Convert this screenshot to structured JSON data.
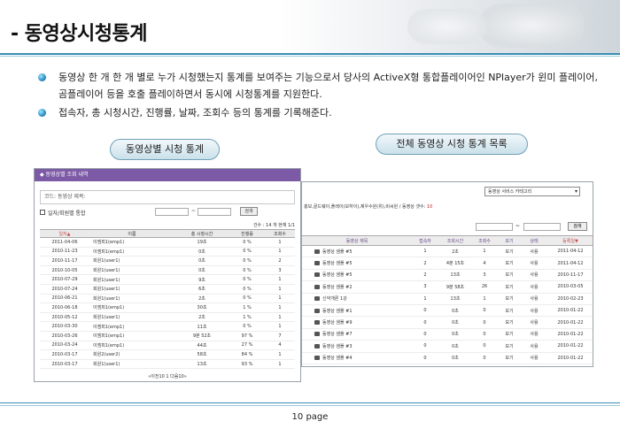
{
  "title": "- 동영상시청통계",
  "bullets": [
    "동영상 한 개 한 개 별로 누가 시청했는지 통계를 보여주는 기능으로서 당사의 ActiveX형 통합플레이어인 NPlayer가 윈미 플레이어, 곰플레이어 등을 호출 플레이하면서 동시에 시청통계를 지원한다.",
    "접속자, 총 시청시간, 진행률, 날짜, 조회수 등의 통계를 기록해준다."
  ],
  "labels": {
    "left_pill": "동영상별 시청 통계",
    "right_pill": "전체 동영상 시청 통계 목록"
  },
  "left_shot": {
    "header": "◆ 동영상별 조회 내역",
    "search_text": "코드: 동영상 제목:",
    "option_label": "일자/회원별 통합",
    "tilde": "~",
    "button": "검색",
    "count": "건수 : 14 개   현재 1/1",
    "columns": [
      "일자▲",
      "이름",
      "총 시청시간",
      "진행률",
      "조회수"
    ],
    "rows": [
      [
        "2011-04-06",
        "이엠피1(emp1)",
        "19초",
        "0 %",
        "1"
      ],
      [
        "2010-11-23",
        "이엠피1(emp1)",
        "0초",
        "0 %",
        "1"
      ],
      [
        "2010-11-17",
        "회원1(user1)",
        "0초",
        "0 %",
        "2"
      ],
      [
        "2010-10-05",
        "회원1(user1)",
        "0초",
        "0 %",
        "3"
      ],
      [
        "2010-07-29",
        "회원1(user1)",
        "9초",
        "0 %",
        "1"
      ],
      [
        "2010-07-24",
        "회원1(user1)",
        "6초",
        "0 %",
        "1"
      ],
      [
        "2010-06-21",
        "회원1(user1)",
        "2초",
        "0 %",
        "1"
      ],
      [
        "2010-06-18",
        "이엠피1(emp1)",
        "30초",
        "1 %",
        "1"
      ],
      [
        "2010-05-12",
        "회원1(user1)",
        "2초",
        "1 %",
        "1"
      ],
      [
        "2010-03-30",
        "이엠피1(emp1)",
        "11초",
        "0 %",
        "1"
      ],
      [
        "2010-03-26",
        "이엠피1(emp1)",
        "9분 52초",
        "97 %",
        "7"
      ],
      [
        "2010-03-24",
        "이엠피1(emp1)",
        "44초",
        "27 %",
        "4"
      ],
      [
        "2010-03-17",
        "회원2(user2)",
        "58초",
        "84 %",
        "1"
      ],
      [
        "2010-03-17",
        "회원1(user1)",
        "13초",
        "93 %",
        "1"
      ]
    ],
    "pager": "«이전10  1  다음10»"
  },
  "right_shot": {
    "select": "동영상 서비스 카테고리",
    "breadcrumb_prefix": "홍보,골드웨이,플레이(보하이),제우수원(위),비씨원 / 동영상 갯수:",
    "breadcrumb_count": "10",
    "tilde": "~",
    "button": "검색",
    "columns": [
      "동영상 제목",
      "접속자",
      "조회시간",
      "조회수",
      "보기",
      "상태",
      "등록일▼"
    ],
    "rows": [
      [
        "동영상 샘플 #5",
        "1",
        "2초",
        "1",
        "보기",
        "사용",
        "2011-04-12"
      ],
      [
        "동영상 샘플 #5",
        "2",
        "4분 15초",
        "4",
        "보기",
        "사용",
        "2011-04-12"
      ],
      [
        "동영상 샘플 #5",
        "2",
        "13초",
        "3",
        "보기",
        "사용",
        "2010-11-17"
      ],
      [
        "동영상 샘플 #2",
        "3",
        "9분 58초",
        "26",
        "보기",
        "사용",
        "2010-03-05"
      ],
      [
        "신약개론 1강",
        "1",
        "13초",
        "1",
        "보기",
        "사용",
        "2010-02-23"
      ],
      [
        "동영상 샘플 #1",
        "0",
        "0초",
        "0",
        "보기",
        "사용",
        "2010-01-22"
      ],
      [
        "동영상 샘플 #9",
        "0",
        "0초",
        "0",
        "보기",
        "사용",
        "2010-01-22"
      ],
      [
        "동영상 샘플 #7",
        "0",
        "0초",
        "0",
        "보기",
        "사용",
        "2010-01-22"
      ],
      [
        "동영상 샘플 #3",
        "0",
        "0초",
        "0",
        "보기",
        "사용",
        "2010-01-22"
      ],
      [
        "동영상 샘플 #4",
        "0",
        "0초",
        "0",
        "보기",
        "사용",
        "2010-01-22"
      ]
    ]
  },
  "footer": "10 page",
  "colors": {
    "accent_rule": "#3a8db3",
    "left_header": "#7d5aa6"
  }
}
